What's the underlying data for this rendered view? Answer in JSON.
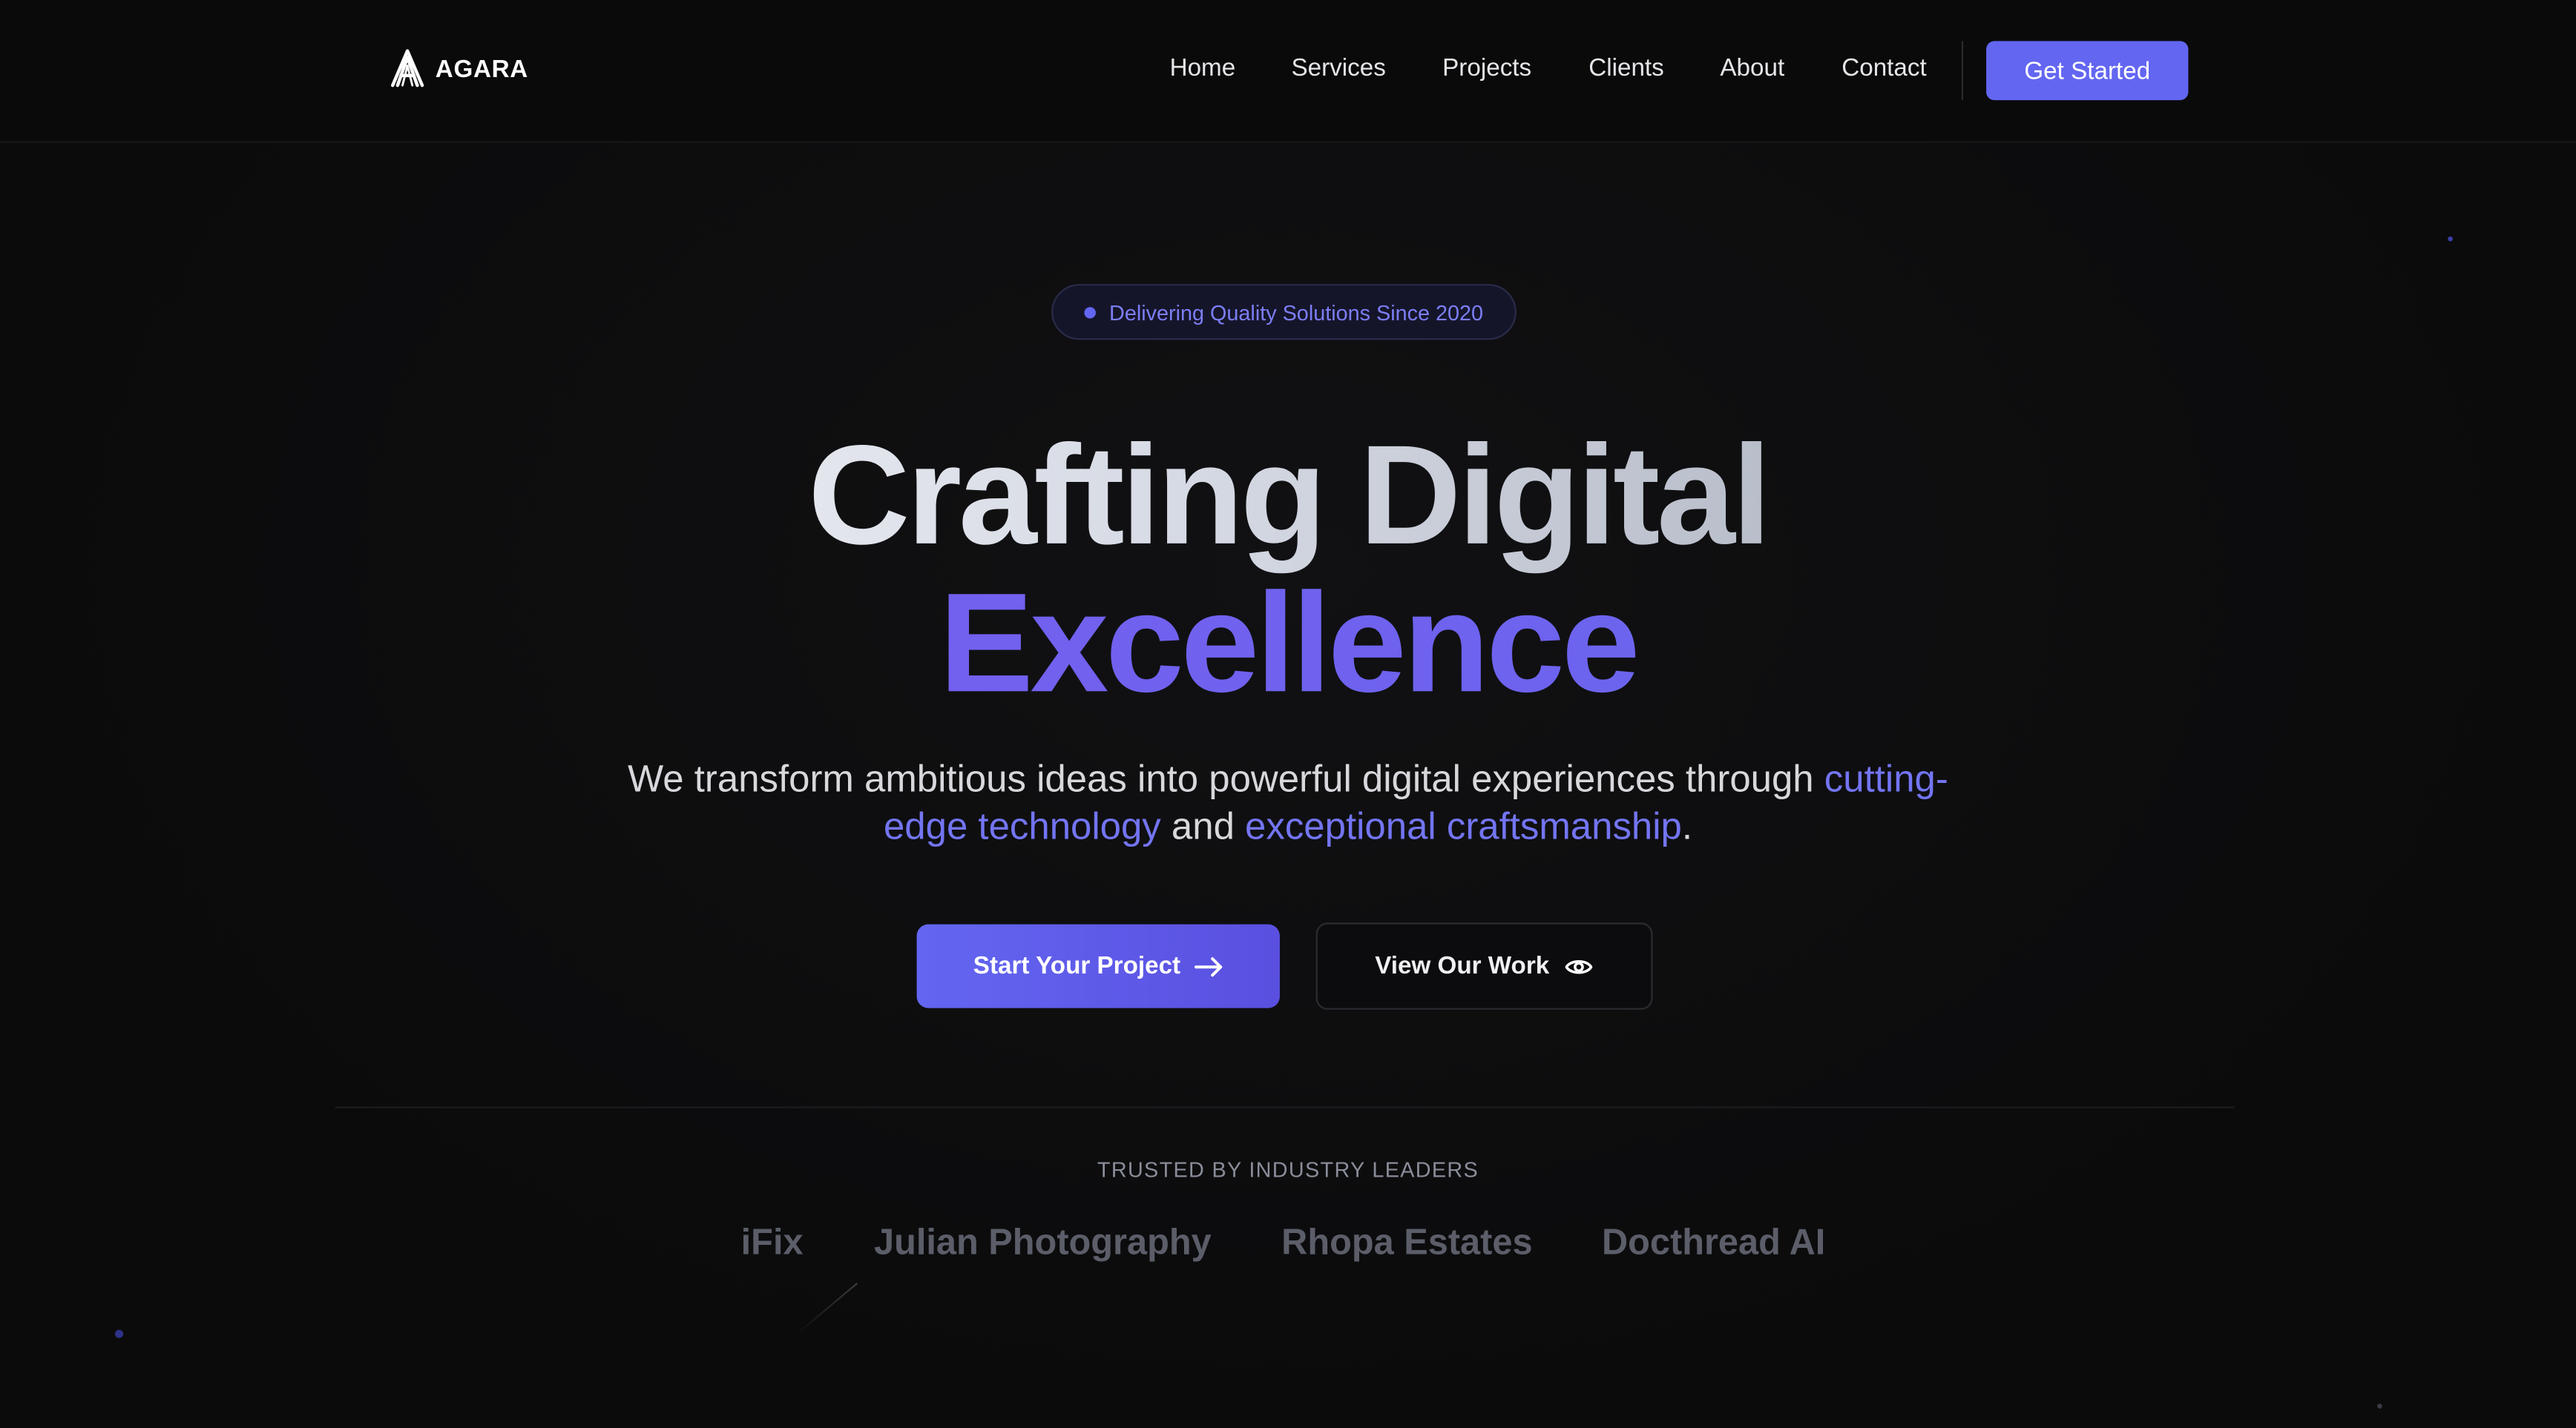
{
  "brand": {
    "name": "AGARA"
  },
  "nav": {
    "items": [
      {
        "label": "Home"
      },
      {
        "label": "Services"
      },
      {
        "label": "Projects"
      },
      {
        "label": "Clients"
      },
      {
        "label": "About"
      },
      {
        "label": "Contact"
      }
    ],
    "cta_label": "Get Started"
  },
  "hero": {
    "badge": "Delivering Quality Solutions Since 2020",
    "headline_line1": "Crafting Digital",
    "headline_line2": "Excellence",
    "subtitle": {
      "part1": "We transform ambitious ideas into powerful digital experiences through ",
      "highlight1": "cutting-edge technology",
      "part2": " and ",
      "highlight2": "exceptional craftsmanship",
      "part3": "."
    },
    "primary_cta": "Start Your Project",
    "primary_cta_icon": "arrow-right-icon",
    "secondary_cta": "View Our Work",
    "secondary_cta_icon": "eye-icon"
  },
  "trusted": {
    "heading": "TRUSTED BY INDUSTRY LEADERS",
    "clients": [
      "iFix",
      "Julian Photography",
      "Rhopa Estates",
      "Docthread AI"
    ]
  },
  "colors": {
    "background": "#0b0b0c",
    "accent": "#6366f1",
    "highlight_text": "#7375f2",
    "client_logo_text": "#5b5e69"
  }
}
